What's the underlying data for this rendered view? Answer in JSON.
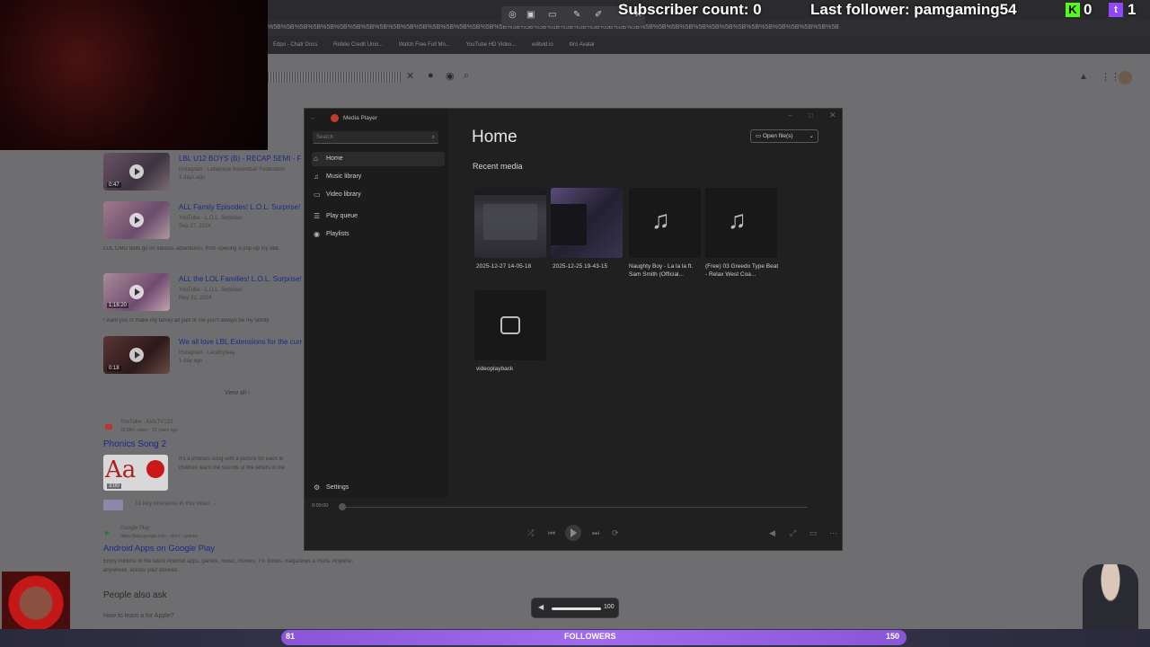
{
  "overlay": {
    "subscriber_count": "Subscriber count: 0",
    "last_follower": "Last follower: pamgaming54",
    "kick_count": "0",
    "twitch_count": "1"
  },
  "browser": {
    "bookmarks": [
      "Edpo - Chatr Docs",
      "Rebilio Credit Unio...",
      "Watch Free Full Mo...",
      "YouTube HD Video...",
      "editvid.io",
      "Itiro Avatar"
    ],
    "tabs_text": "%5B%5B%5B%5B%5B%5B%5B%5B%5B%5B%5B%5B%5B%5B%5B%5B%5B%5B%5B%5B%5B%5B%5B%5B%5B%5B%5B%5B%5B%5B%5B%5B%5B%5B%5B%5B%5B%5B%5B%5B%5B%5B%5B"
  },
  "google": {
    "results": [
      {
        "title": "LBL U12 BOYS (B) - RECAP SEMI - F",
        "source": "Instagram · Lebanese Basketball Federation",
        "date": "3 days ago",
        "duration": "0:47",
        "desc": ""
      },
      {
        "title": "ALL Family Episodes! L.O.L. Surprise!",
        "source": "YouTube · L.O.L. Surprise!",
        "date": "Sep 27, 2024",
        "duration": "",
        "desc": "LOL OMG dolls go on various adventures, from opening a pop-up toy bell."
      },
      {
        "title": "ALL the LOL Families! L.O.L. Surprise!",
        "source": "YouTube · L.O.L. Surprise!",
        "date": "May 31, 2024",
        "duration": "1:18:20",
        "desc": "I want you to make my family all part of me you'll always be my family."
      },
      {
        "title": "We all love LBL Extensions for the curr",
        "source": "Instagram · Leodhylaay",
        "date": "1 day ago",
        "duration": "0:18",
        "desc": ""
      }
    ],
    "view_all": "View all",
    "kids": {
      "source": "YouTube · KidsTV123",
      "views": "33.8M+ views · 15 years ago",
      "title": "Phonics Song 2",
      "desc1": "It's a phonics song with a picture for each le",
      "desc2": "children learn the sounds of the letters in the",
      "duration": "3:00",
      "key_moments": "10 key moments in this video"
    },
    "play": {
      "source": "Google Play",
      "url": "https://play.google.com › store › games",
      "title": "Android Apps on Google Play",
      "desc1": "Enjoy millions of the latest Android apps, games, music, movies, TV, books, magazines & more. Anytime,",
      "desc2": "anywhere, across your devices."
    },
    "people_also_ask": "People also ask",
    "question": "How to learn a for Apple?"
  },
  "media_player": {
    "app_title": "Media Player",
    "search_placeholder": "Search",
    "nav": [
      "Home",
      "Music library",
      "Video library",
      "Play queue",
      "Playlists"
    ],
    "settings": "Settings",
    "heading": "Home",
    "open_button": "Open file(s)",
    "section": "Recent media",
    "items": [
      {
        "label": "2025-12-27 14-05-18",
        "kind": "video"
      },
      {
        "label": "2025-12-25 19-43-15",
        "kind": "video"
      },
      {
        "label": "Naughty Boy - La la la ft. Sam Smith (Official...",
        "kind": "music"
      },
      {
        "label": "(Free) 03 Greedo Type Beat - Relax West Coa...",
        "kind": "music"
      },
      {
        "label": "videoplayback",
        "kind": "file"
      }
    ],
    "time": "0:00:00"
  },
  "volume": {
    "value": "100",
    "level": 1.0
  },
  "followers_bar": {
    "left": "81",
    "label": "FOLLOWERS",
    "right": "150"
  }
}
